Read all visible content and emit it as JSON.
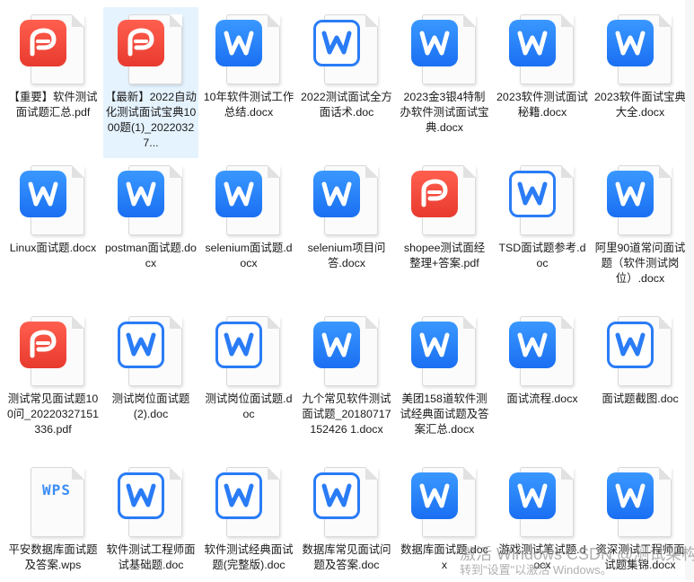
{
  "files": [
    {
      "name": "【重要】软件测试面试题汇总.pdf",
      "type": "pdf"
    },
    {
      "name": "【最新】2022自动化测试面试宝典1000题(1)_20220327...",
      "type": "pdf",
      "selected": true
    },
    {
      "name": "10年软件测试工作总结.docx",
      "type": "w"
    },
    {
      "name": "2022测试面试全方面话术.doc",
      "type": "wo"
    },
    {
      "name": "2023金3银4特制办软件测试面试宝典.docx",
      "type": "w"
    },
    {
      "name": "2023软件测试面试秘籍.docx",
      "type": "w"
    },
    {
      "name": "2023软件面试宝典大全.docx",
      "type": "w"
    },
    {
      "name": "Linux面试题.docx",
      "type": "w"
    },
    {
      "name": "postman面试题.docx",
      "type": "w"
    },
    {
      "name": "selenium面试题.docx",
      "type": "w"
    },
    {
      "name": "selenium项目问答.docx",
      "type": "w"
    },
    {
      "name": "shopee测试面经整理+答案.pdf",
      "type": "pdf"
    },
    {
      "name": "TSD面试题参考.doc",
      "type": "wo"
    },
    {
      "name": "阿里90道常问面试题（软件测试岗位）.docx",
      "type": "w"
    },
    {
      "name": "测试常见面试题100问_20220327151336.pdf",
      "type": "pdf"
    },
    {
      "name": "测试岗位面试题(2).doc",
      "type": "wo"
    },
    {
      "name": "测试岗位面试题.doc",
      "type": "wo"
    },
    {
      "name": "九个常见软件测试面试题_20180717152426 1.docx",
      "type": "w"
    },
    {
      "name": "美团158道软件测试经典面试题及答案汇总.docx",
      "type": "w"
    },
    {
      "name": "面试流程.docx",
      "type": "w"
    },
    {
      "name": "面试题截图.doc",
      "type": "wo"
    },
    {
      "name": "平安数据库面试题及答案.wps",
      "type": "wps"
    },
    {
      "name": "软件测试工程师面试基础题.doc",
      "type": "wo"
    },
    {
      "name": "软件测试经典面试题(完整版).doc",
      "type": "wo"
    },
    {
      "name": "数据库常见面试问题及答案.doc",
      "type": "wo"
    },
    {
      "name": "数据库面试题.docx",
      "type": "w"
    },
    {
      "name": "游戏测试笔试题.docx",
      "type": "w"
    },
    {
      "name": "资深测试工程师面试题集锦.docx",
      "type": "w"
    }
  ],
  "watermark": {
    "line1": "激活 Windows CSDN @测试架构师北凡",
    "line2": "转到\"设置\"以激活 Windows。"
  },
  "colors": {
    "word": "#1a6ff2",
    "pdf": "#e83a2e",
    "selection": "#e5f3ff"
  }
}
